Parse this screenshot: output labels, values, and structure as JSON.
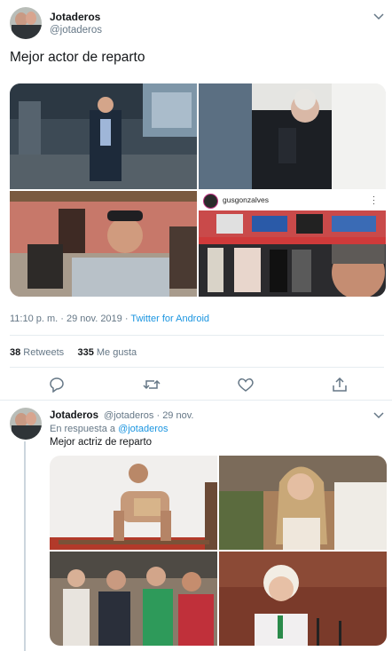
{
  "main_tweet": {
    "display_name": "Jotaderos",
    "handle": "@jotaderos",
    "text": "Mejor actor de reparto",
    "timestamp": "11:10 p. m. · 29 nov. 2019 · ",
    "source": "Twitter for Android",
    "retweets_count": "38",
    "retweets_label": " Retweets",
    "likes_count": "335",
    "likes_label": " Me gusta",
    "embedded_username": "gusgonzalves"
  },
  "reply_tweet": {
    "display_name": "Jotaderos",
    "handle_and_date": "@jotaderos · 29 nov.",
    "reply_prefix": "En respuesta a ",
    "reply_to_user": "@jotaderos",
    "text": "Mejor actriz de reparto"
  },
  "colors": {
    "text": "#14171a",
    "secondary": "#657786",
    "link": "#1b95e0",
    "divider": "#e6ecf0"
  },
  "icons": [
    "chevron-down-icon",
    "reply-icon",
    "retweet-icon",
    "like-icon",
    "share-icon"
  ]
}
